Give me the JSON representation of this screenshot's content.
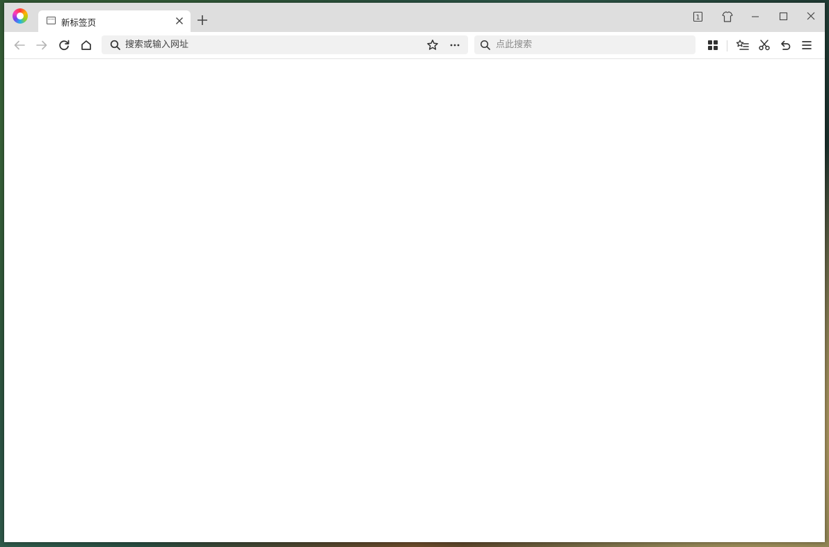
{
  "browser": {
    "tab": {
      "title": "新标签页",
      "close_icon": "close-icon",
      "page_icon": "newtab-page-icon"
    },
    "new_tab_label": "+",
    "window_controls": {
      "tab_count": "1",
      "skin_icon": "tshirt-icon",
      "minimize_icon": "minimize-icon",
      "maximize_icon": "maximize-icon",
      "close_icon": "close-icon"
    },
    "toolbar": {
      "back_icon": "arrow-left-icon",
      "forward_icon": "arrow-right-icon",
      "refresh_icon": "refresh-icon",
      "home_icon": "home-icon",
      "address_placeholder": "搜索或输入网址",
      "address_value": "",
      "bookmark_icon": "star-icon",
      "more_icon": "ellipsis-icon",
      "search_placeholder": "点此搜索",
      "search_value": "",
      "apps_icon": "grid-icon",
      "favorites_icon": "star-list-icon",
      "screenshot_icon": "scissors-icon",
      "undo_icon": "undo-icon",
      "menu_icon": "hamburger-menu-icon"
    }
  }
}
